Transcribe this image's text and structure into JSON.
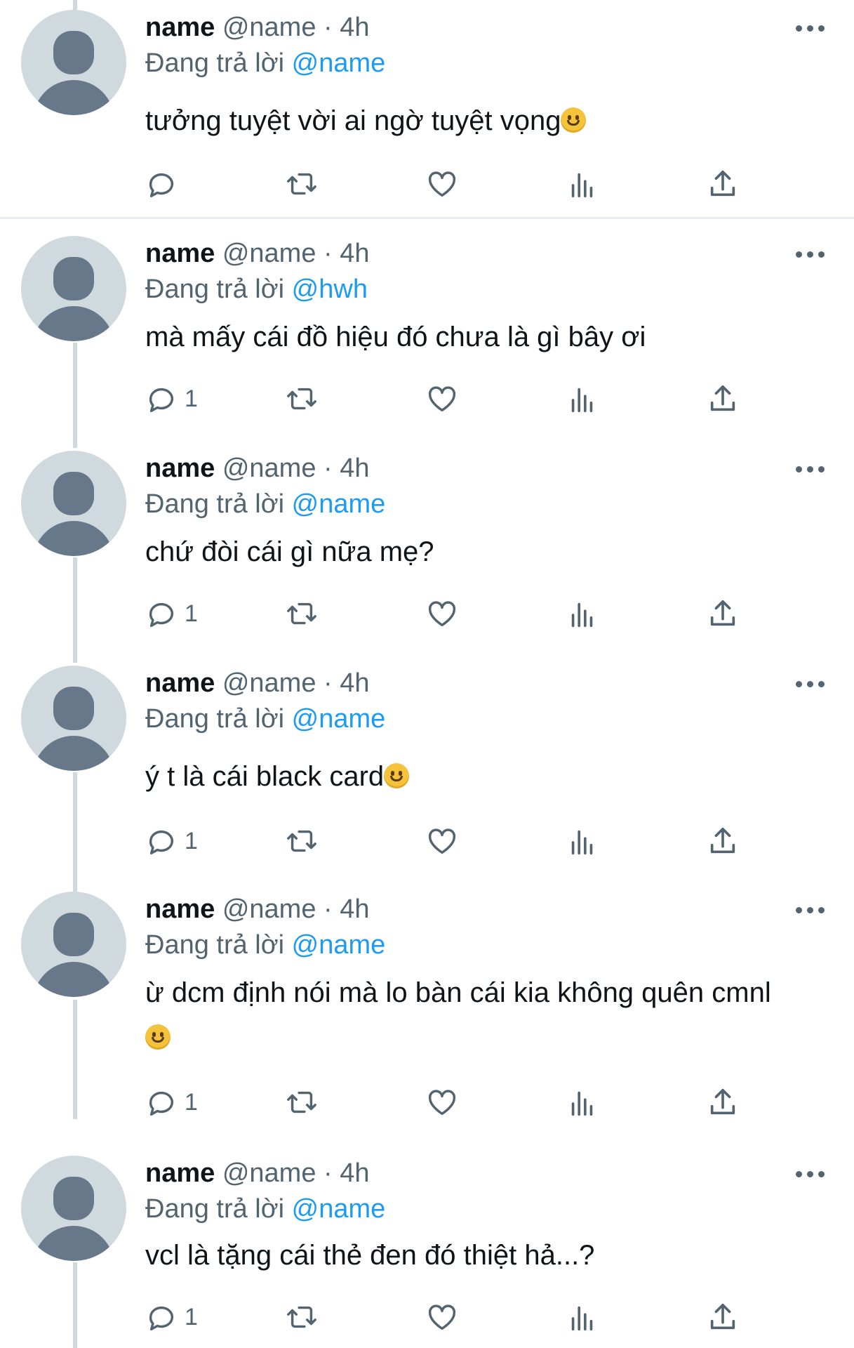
{
  "tweets": [
    {
      "name": "name",
      "handle": "@name",
      "dot": "·",
      "time": "4h",
      "reply_prefix": "Đang trả lời",
      "reply_to": "@name",
      "text": "tưởng tuyệt vời ai ngờ tuyệt vọng",
      "emoji_inline": true,
      "reply_count": ""
    },
    {
      "name": "name",
      "handle": "@name",
      "dot": "·",
      "time": "4h",
      "reply_prefix": "Đang trả lời",
      "reply_to": "@hwh",
      "text": "mà mấy cái đồ hiệu đó chưa là gì bây ơi",
      "reply_count": "1"
    },
    {
      "name": "name",
      "handle": "@name",
      "dot": "·",
      "time": "4h",
      "reply_prefix": "Đang trả lời",
      "reply_to": "@name",
      "text": "chứ đòi cái gì nữa mẹ?",
      "reply_count": "1"
    },
    {
      "name": "name",
      "handle": "@name",
      "dot": "·",
      "time": "4h",
      "reply_prefix": "Đang trả lời",
      "reply_to": "@name",
      "text": "ý t là cái black card",
      "emoji_inline": true,
      "reply_count": "1"
    },
    {
      "name": "name",
      "handle": "@name",
      "dot": "·",
      "time": "4h",
      "reply_prefix": "Đang trả lời",
      "reply_to": "@name",
      "text": "ừ dcm định nói mà lo bàn cái kia không quên cmnl",
      "emoji_newline": true,
      "reply_count": "1"
    },
    {
      "name": "name",
      "handle": "@name",
      "dot": "·",
      "time": "4h",
      "reply_prefix": "Đang trả lời",
      "reply_to": "@name",
      "text": "vcl là tặng cái thẻ đen đó thiệt hả...?",
      "reply_count": "1"
    }
  ],
  "icons": {
    "reply": "reply-icon",
    "retweet": "retweet-icon",
    "like": "heart-icon",
    "views": "analytics-icon",
    "share": "share-icon",
    "more": "more-icon",
    "emoji": "slightly-smiling-face-emoji"
  },
  "colors": {
    "link": "#1d9bf0",
    "secondary": "#536471",
    "thread_line": "#cfd9de"
  }
}
